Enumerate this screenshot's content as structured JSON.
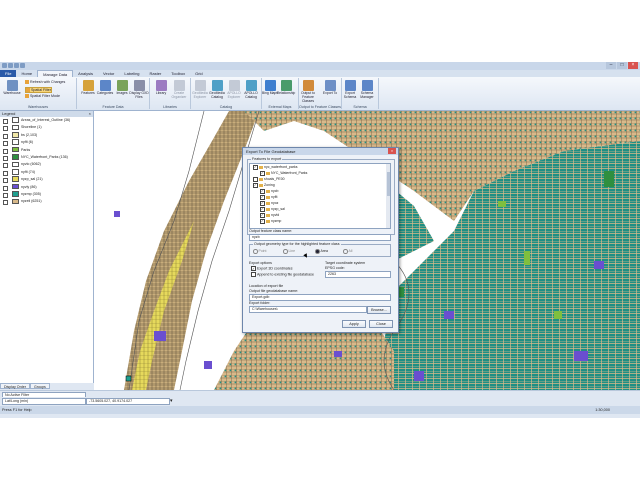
{
  "window": {
    "title": "",
    "controls": [
      "–",
      "□",
      "×"
    ]
  },
  "tabs": [
    "File",
    "Home",
    "Manage Data",
    "Analysis",
    "Vector",
    "Labeling",
    "Raster",
    "Toolbox",
    "Grid"
  ],
  "active_tab": "Manage Data",
  "ribbon": {
    "groups": [
      {
        "label": "Warehouses",
        "buttons": [
          "Warehouse"
        ],
        "small": [
          "Refresh with Changes",
          "Spatial Filter",
          "Spatial Filter Mode"
        ]
      },
      {
        "label": "Feature Data",
        "buttons": [
          "Features",
          "Categories",
          "Images",
          "Display GXD Files"
        ]
      },
      {
        "label": "Libraries",
        "buttons": [
          "Library",
          "Create Organizer"
        ]
      },
      {
        "label": "Catalog",
        "buttons": [
          "GeoMedia Explorer",
          "GeoMedia Catalog",
          "APOLLO Explorer",
          "APOLLO Catalog"
        ]
      },
      {
        "label": "External Maps",
        "buttons": [
          "Bing Maps",
          "Relationship"
        ]
      },
      {
        "label": "Output to Feature Classes",
        "buttons": [
          "Output to Feature Classes",
          "Export To"
        ]
      },
      {
        "label": "Schema",
        "buttons": [
          "Export Schema",
          "Schema Manager"
        ]
      }
    ]
  },
  "legend": {
    "title": "Legend",
    "items": [
      {
        "label": "Areas_of_Interest_Outline (36)",
        "color": "#ffffff"
      },
      {
        "label": "Shoreline (1)",
        "color": "#ffffff"
      },
      {
        "label": "bs (2,103)",
        "color": "#f1e8a8"
      },
      {
        "label": "nyflt (6)",
        "color": "#ffffff"
      },
      {
        "label": "Parks",
        "color": "#7fbf3f"
      },
      {
        "label": "NYC_Waterfront_Parks (136)",
        "color": "#2f8f3f"
      },
      {
        "label": "nyvlo (6062)",
        "color": "#ffffff"
      },
      {
        "label": "nyflt (74)",
        "color": "#ffffff"
      },
      {
        "label": "nyzp_sal (21)",
        "color": "#e6d95c"
      },
      {
        "label": "nyvly (86)",
        "color": "#6a4fd0"
      },
      {
        "label": "nyzmp (305)",
        "color": "#1f9f8f"
      },
      {
        "label": "nyzeil (6251)",
        "color": "#d8b98a"
      }
    ],
    "tabs": [
      "Display Order",
      "Groups"
    ]
  },
  "status": {
    "filter_label": "No Active Filter",
    "coord_system": "Lat/Long (min)",
    "coordinates": "-73.5605.027, 40.9174.027",
    "help": "Press F1 for Help",
    "scale": "1:30,000"
  },
  "dialog": {
    "title": "Export To File Geodatabase",
    "features_caption": "Features to export",
    "tree": [
      {
        "label": "nyc_waterfront_parks",
        "checked": true,
        "selected": false
      },
      {
        "label": "NYC_Waterfront_Parks",
        "checked": true,
        "selected": false
      },
      {
        "label": "shoals_PE00",
        "checked": false,
        "selected": false
      },
      {
        "label": "Zoning",
        "checked": true,
        "selected": false
      },
      {
        "label": "nycb",
        "checked": true,
        "selected": false
      },
      {
        "label": "nyflt",
        "checked": true,
        "selected": false
      },
      {
        "label": "nyoz",
        "checked": true,
        "selected": false
      },
      {
        "label": "nyzp_sal",
        "checked": true,
        "selected": false
      },
      {
        "label": "nyvld",
        "checked": true,
        "selected": false
      },
      {
        "label": "nyzmp",
        "checked": true,
        "selected": false
      }
    ],
    "output_name_label": "Output feature class name:",
    "output_name_value": "nyzb",
    "geometry_caption": "Output geometry type for the highlighted feature class",
    "geometry_options": [
      {
        "label": "Point",
        "on": false
      },
      {
        "label": "Line",
        "on": false
      },
      {
        "label": "Area",
        "on": true
      },
      {
        "label": "All",
        "on": false
      }
    ],
    "export_options_caption": "Export options",
    "export_3d": "Export 3D coordinates",
    "append": "Append to existing file geodatabase",
    "target_cs_caption": "Target coordinate system",
    "epsg_label": "EPSG code:",
    "epsg_value": "2263",
    "location_caption": "Location of export file",
    "gdb_name_label": "Output file geodatabase name:",
    "gdb_name_value": "Export.gdb",
    "folder_label": "Export folder:",
    "folder_value": "C:\\Warehouses\\",
    "browse": "Browse...",
    "apply": "Apply",
    "close": "Close"
  }
}
